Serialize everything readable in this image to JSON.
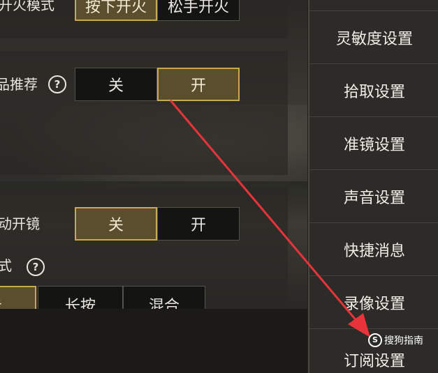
{
  "settings": {
    "fire_mode": {
      "label": "开火模式",
      "options": [
        "按下开火",
        "松手开火"
      ],
      "selected": "按下开火"
    },
    "recommend": {
      "label": "品推荐",
      "help": "?",
      "options": [
        "关",
        "开"
      ],
      "selected": "开"
    },
    "auto_scope": {
      "label": "动开镜",
      "options": [
        "关",
        "开"
      ],
      "selected": "关"
    },
    "scope_mode": {
      "label": "式",
      "help": "?",
      "options": [
        "击",
        "长按",
        "混合"
      ],
      "selected": "击"
    }
  },
  "menu": {
    "items": [
      "灵敏度设置",
      "拾取设置",
      "准镜设置",
      "声音设置",
      "快捷消息",
      "录像设置",
      "订阅设置"
    ]
  },
  "watermark": {
    "logo": "S",
    "text": "搜狗指南"
  },
  "colors": {
    "accent": "#c9a950",
    "arrow": "#e8333a",
    "menu_bg": "#2c2b28"
  }
}
